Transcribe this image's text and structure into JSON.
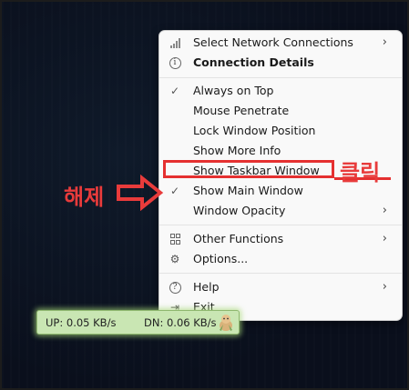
{
  "menu": {
    "items": [
      {
        "label": "Select Network Connections",
        "icon": "signal-bars-icon",
        "submenu": true
      },
      {
        "label": "Connection Details",
        "icon": "info-icon",
        "bold": true
      },
      {
        "label": "Always on Top",
        "checked": true
      },
      {
        "label": "Mouse Penetrate"
      },
      {
        "label": "Lock Window Position"
      },
      {
        "label": "Show More Info"
      },
      {
        "label": "Show Taskbar Window"
      },
      {
        "label": "Show Main Window",
        "checked": true
      },
      {
        "label": "Window Opacity",
        "submenu": true
      },
      {
        "label": "Other Functions",
        "icon": "grid-icon",
        "submenu": true
      },
      {
        "label": "Options...",
        "icon": "gear-icon"
      },
      {
        "label": "Help",
        "icon": "question-icon",
        "submenu": true
      },
      {
        "label": "Exit",
        "icon": "exit-icon"
      }
    ],
    "glyphs": {
      "chevron": "›",
      "check": "✓",
      "info": "i",
      "question": "?",
      "gear": "⚙",
      "exit": "⇥"
    }
  },
  "annotations": {
    "click_label": "클릭",
    "release_label": "해제",
    "color": "#e83b3b"
  },
  "widget": {
    "upload": "UP: 0.05 KB/s",
    "download": "DN: 0.06 KB/s"
  }
}
